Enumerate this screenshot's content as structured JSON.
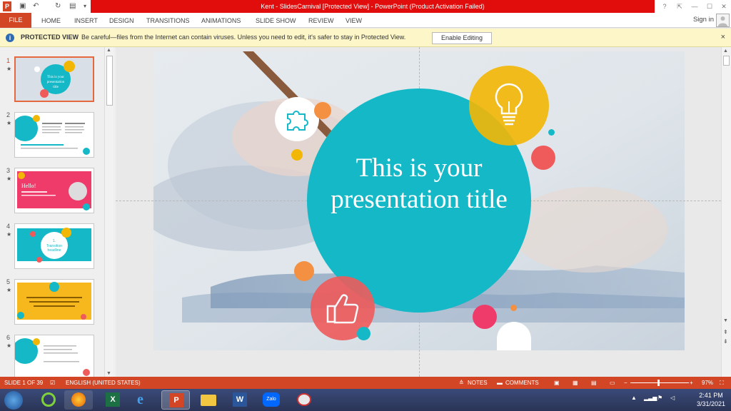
{
  "window": {
    "title": "Kent - SlidesCarnival [Protected View] -  PowerPoint (Product Activation Failed)",
    "controls": [
      "?",
      "—",
      "☐",
      "✕"
    ]
  },
  "ribbon": {
    "tabs": [
      "FILE",
      "HOME",
      "INSERT",
      "DESIGN",
      "TRANSITIONS",
      "ANIMATIONS",
      "SLIDE SHOW",
      "REVIEW",
      "VIEW"
    ],
    "sign_in": "Sign in"
  },
  "protected_view": {
    "label": "PROTECTED VIEW",
    "message": "Be careful—files from the Internet can contain viruses. Unless you need to edit, it's safer to stay in Protected View.",
    "button": "Enable Editing",
    "close": "×"
  },
  "slides_panel": {
    "thumbnails": [
      {
        "number": "1",
        "caption": "This is your presentation title"
      },
      {
        "number": "2",
        "caption": "Instructions for use"
      },
      {
        "number": "3",
        "caption": "Hello!"
      },
      {
        "number": "4",
        "caption": "Transition headline"
      },
      {
        "number": "5",
        "caption": "Quotation"
      },
      {
        "number": "6",
        "caption": "This is a slide title"
      }
    ]
  },
  "slide": {
    "title": "This is your presentation title",
    "colors": {
      "teal": "#14b8c6",
      "yellow": "#f2b705",
      "coral": "#ef5b5b",
      "orange": "#f39041",
      "pink": "#ee3b6a"
    }
  },
  "statusbar": {
    "slide_info": "SLIDE 1 OF 39",
    "language": "ENGLISH (UNITED STATES)",
    "notes": "NOTES",
    "comments": "COMMENTS",
    "zoom": "97%"
  },
  "taskbar": {
    "apps": [
      "start-orb",
      "app-green",
      "firefox",
      "excel",
      "internet-explorer",
      "powerpoint",
      "file-explorer",
      "word",
      "zalo",
      "snipping-tool"
    ],
    "zalo_label": "Zalo",
    "time": "2:41 PM",
    "date": "3/31/2021"
  }
}
